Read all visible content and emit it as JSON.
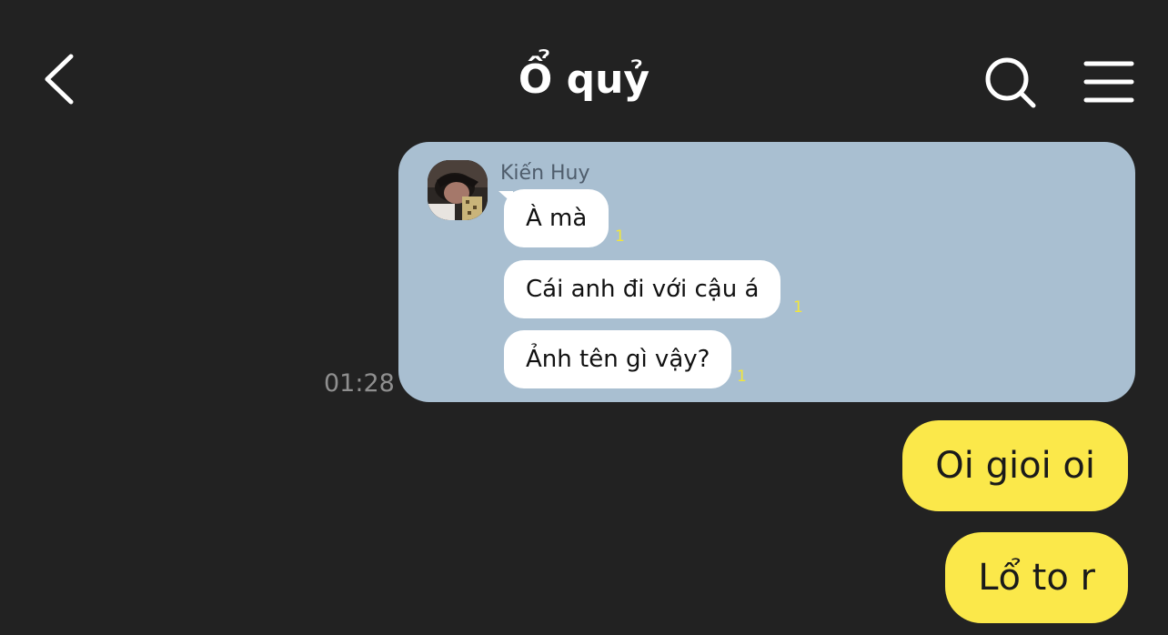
{
  "header": {
    "title": "Ổ quỷ"
  },
  "quoted_message": {
    "sender": "Kiến Huy",
    "messages": [
      {
        "text": "À mà",
        "read_count": "1"
      },
      {
        "text": "Cái anh đi với cậu á",
        "read_count": "1"
      },
      {
        "text": "Ảnh tên gì vậy?",
        "read_count": "1"
      }
    ],
    "time": "01:28"
  },
  "my_messages": [
    {
      "text": "Oi gioi oi"
    },
    {
      "text": "Lổ to r"
    }
  ],
  "colors": {
    "background": "#222222",
    "quote_card": "#a9bfd1",
    "my_bubble": "#fbe84a",
    "read_count": "#f2e63a"
  },
  "icons": {
    "back": "chevron-left-icon",
    "search": "search-icon",
    "menu": "hamburger-menu-icon"
  }
}
